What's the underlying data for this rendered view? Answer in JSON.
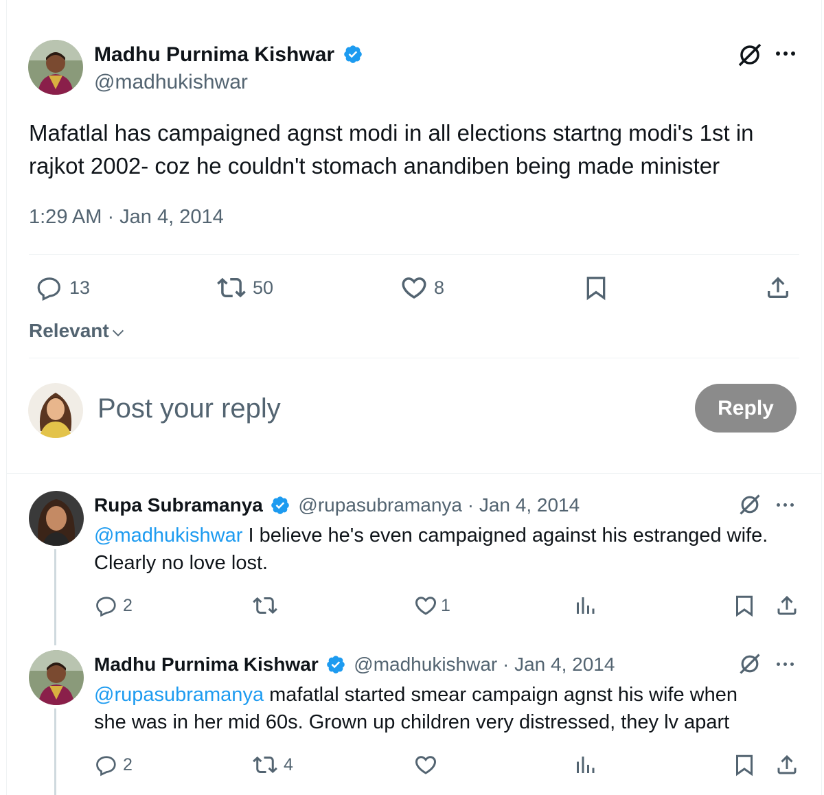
{
  "main_post": {
    "author_name": "Madhu Purnima Kishwar",
    "handle": "@madhukishwar",
    "text_line1": "Mafatlal has campaigned agnst modi in all elections startng modi's 1st in",
    "text_line2": "rajkot 2002- coz he couldn't stomach anandiben being made minister",
    "timestamp": "1:29 AM · Jan 4, 2014",
    "replies": "13",
    "reposts": "50",
    "likes": "8"
  },
  "sort": {
    "label": "Relevant"
  },
  "composer": {
    "placeholder": "Post your reply",
    "button": "Reply"
  },
  "replies": [
    {
      "author_name": "Rupa Subramanya",
      "meta": "@rupasubramanya · Jan 4, 2014",
      "mention": "@madhukishwar",
      "text_line1": " I believe he's even campaigned against his estranged wife.",
      "text_line2": "Clearly no love lost.",
      "replies": "2",
      "reposts": "",
      "likes": "1"
    },
    {
      "author_name": "Madhu Purnima Kishwar",
      "meta": "@madhukishwar · Jan 4, 2014",
      "mention": "@rupasubramanya",
      "text_line1": " mafatlal started smear campaign agnst his wife when",
      "text_line2": "she was in her mid 60s. Grown up children very distressed, they lv apart",
      "replies": "2",
      "reposts": "4",
      "likes": ""
    }
  ],
  "colors": {
    "verified": "#1d9bf0",
    "link": "#1d9bf0",
    "muted": "#536471",
    "reply_button": "#8b8b8b"
  }
}
